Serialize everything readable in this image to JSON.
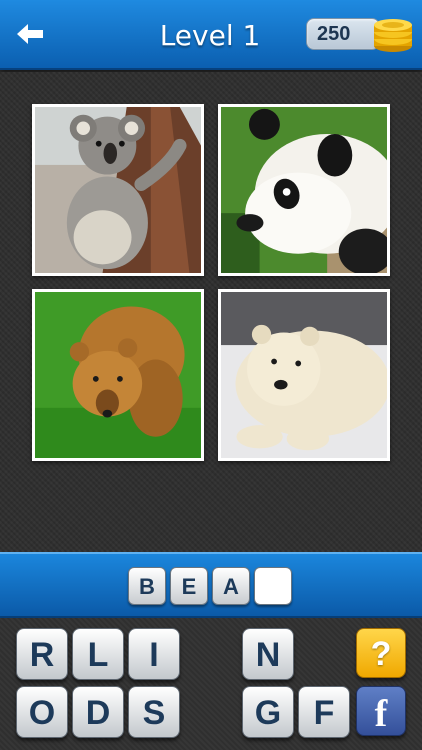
{
  "header": {
    "title": "Level 1",
    "coins": "250",
    "back_icon": "back-arrow-icon",
    "coins_icon": "gold-coins-icon"
  },
  "photos": [
    {
      "subject": "koala"
    },
    {
      "subject": "panda"
    },
    {
      "subject": "brown-bear"
    },
    {
      "subject": "polar-bear"
    }
  ],
  "answer": {
    "letters": [
      "B",
      "E",
      "A",
      ""
    ]
  },
  "keyboard": {
    "row1": [
      "R",
      "L",
      "I",
      "",
      "N"
    ],
    "row2": [
      "O",
      "D",
      "S",
      "",
      "G",
      "F"
    ],
    "hint_label": "?",
    "facebook_label": "f"
  },
  "colors": {
    "header_blue": "#0b5fb0",
    "hint_yellow": "#f0a800",
    "facebook_blue": "#34509a"
  }
}
